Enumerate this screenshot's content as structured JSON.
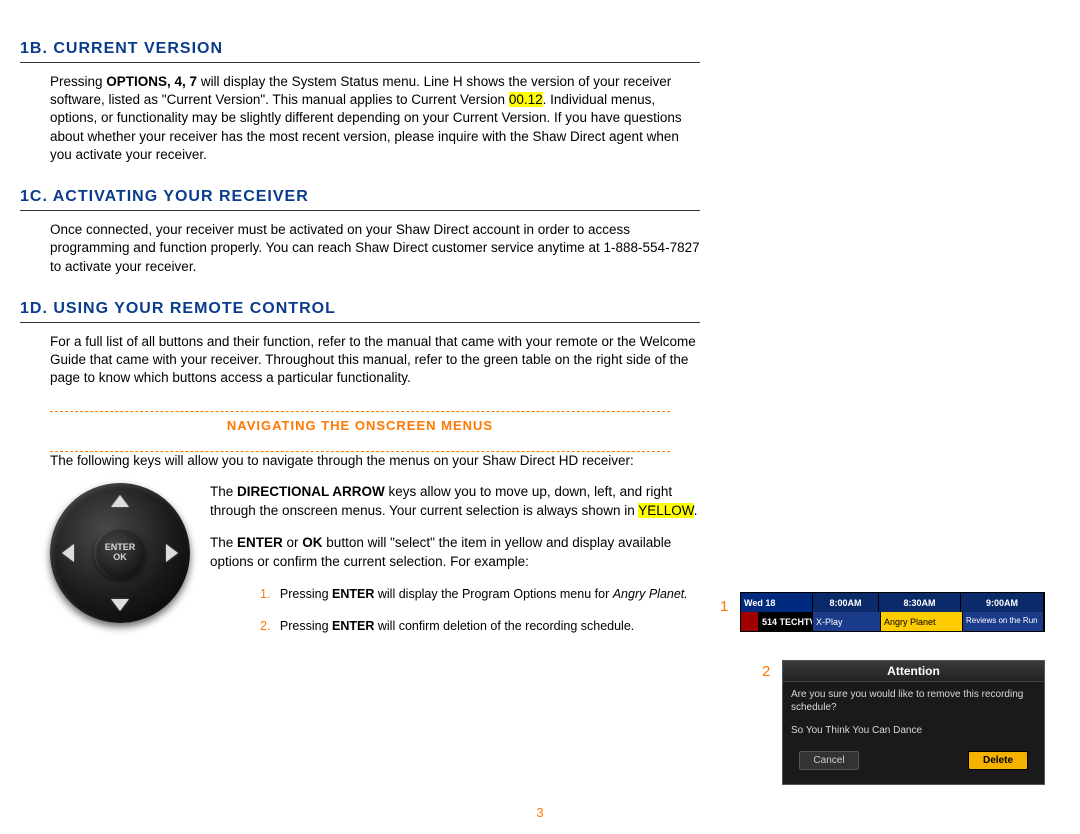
{
  "sections": {
    "b": {
      "heading": "1B. CURRENT VERSION",
      "p1_a": "Pressing ",
      "p1_b": "OPTIONS, 4, 7",
      "p1_c": " will display the System Status menu.  Line H shows the version of your receiver software, listed as \"Current Version\".  This manual applies to Current Version ",
      "p1_hl": "00.12",
      "p1_d": ".  Individual menus, options, or functionality may be slightly different depending on your Current Version.  If you have questions about whether your receiver has the most recent version, please inquire with the Shaw Direct agent when you activate your receiver."
    },
    "c": {
      "heading": "1C. ACTIVATING YOUR RECEIVER",
      "p1": "Once connected, your receiver must be activated on your Shaw Direct account in order to access programming and function properly.  You can reach Shaw Direct customer service anytime at 1-888-554-7827 to activate your receiver."
    },
    "d": {
      "heading": "1D. USING YOUR REMOTE CONTROL",
      "p1": "For a full list of all buttons and their function, refer to the manual that came with your remote or the Welcome Guide that came with your receiver.  Throughout this manual, refer to the green table on the right side of the page to know which buttons access a particular functionality.",
      "subheading": "NAVIGATING THE ONSCREEN MENUS",
      "p2": "The following keys will allow you to navigate through the menus on your Shaw Direct HD receiver:",
      "dir_a": "The ",
      "dir_b": "DIRECTIONAL ARROW",
      "dir_c": " keys allow you to move up, down, left, and right through the onscreen menus.  Your current selection is always shown in ",
      "dir_hl": "YELLOW",
      "dir_d": ".",
      "enter_a": "The ",
      "enter_b": "ENTER",
      "enter_c": " or ",
      "enter_d": "OK",
      "enter_e": " button will \"select\" the item in yellow and display available options or confirm the current selection.  For example:",
      "ex1_n": "1.",
      "ex1_a": "Pressing ",
      "ex1_b": "ENTER",
      "ex1_c": " will display the Program Options menu for ",
      "ex1_i": "Angry Planet.",
      "ex2_n": "2.",
      "ex2_a": "Pressing ",
      "ex2_b": "ENTER",
      "ex2_c": " will confirm deletion of the recording schedule."
    }
  },
  "remote": {
    "enter": "ENTER",
    "ok": "OK"
  },
  "guide": {
    "wed": "Wed 18",
    "t1": "8:00AM",
    "t2": "8:30AM",
    "t3": "9:00AM",
    "chnum": "514",
    "chname": "TECHTV",
    "xplay": "X-Play",
    "angry": "Angry Planet",
    "reviews": "Reviews on the Run"
  },
  "dialog": {
    "title": "Attention",
    "line1": "Are you sure you would like to remove this recording schedule?",
    "line2": "So You Think You Can Dance",
    "cancel": "Cancel",
    "delete": "Delete"
  },
  "callouts": {
    "n1": "1",
    "n2": "2"
  },
  "page_number": "3"
}
